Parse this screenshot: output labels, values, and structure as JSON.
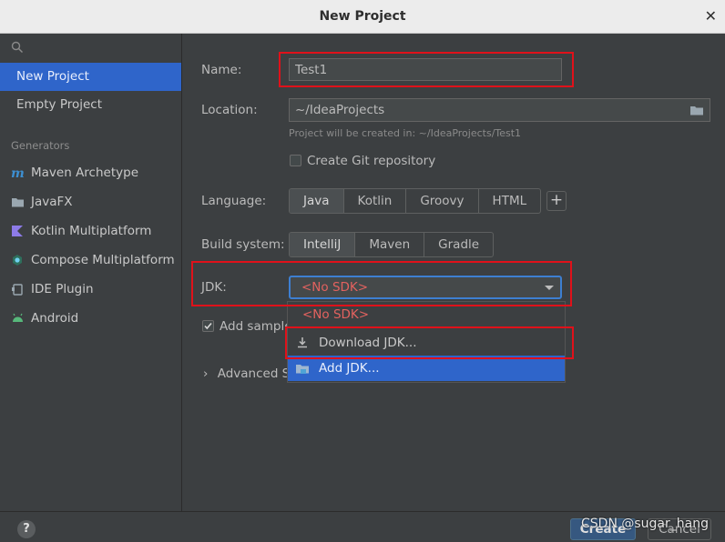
{
  "window": {
    "title": "New Project"
  },
  "sidebar": {
    "nav": [
      {
        "label": "New Project",
        "selected": true
      },
      {
        "label": "Empty Project",
        "selected": false
      }
    ],
    "generators_label": "Generators",
    "generators": [
      {
        "label": "Maven Archetype",
        "icon": "maven-icon",
        "color": "#3d8fd1"
      },
      {
        "label": "JavaFX",
        "icon": "folder-icon",
        "color": "#9aa7b0"
      },
      {
        "label": "Kotlin Multiplatform",
        "icon": "kotlin-icon",
        "color": "#8d7be8"
      },
      {
        "label": "Compose Multiplatform",
        "icon": "compose-icon",
        "color": "#4fc1a0"
      },
      {
        "label": "IDE Plugin",
        "icon": "plugin-icon",
        "color": "#9aa7b0"
      },
      {
        "label": "Android",
        "icon": "android-icon",
        "color": "#57b87b"
      }
    ]
  },
  "form": {
    "name_label": "Name:",
    "name_value": "Test1",
    "location_label": "Location:",
    "location_value": "~/IdeaProjects",
    "location_hint": "Project will be created in: ~/IdeaProjects/Test1",
    "git_label": "Create Git repository",
    "language_label": "Language:",
    "languages": [
      "Java",
      "Kotlin",
      "Groovy",
      "HTML"
    ],
    "build_label": "Build system:",
    "build_systems": [
      "IntelliJ",
      "Maven",
      "Gradle"
    ],
    "jdk_label": "JDK:",
    "jdk_value": "<No SDK>",
    "sample_label": "Add sample",
    "advanced_label": "Advanced Se"
  },
  "jdk_popup": {
    "items": [
      {
        "label": "<No SDK>",
        "color": "#e3625f"
      },
      {
        "label": "Download JDK...",
        "icon": "download-icon"
      },
      {
        "label": "Add JDK...",
        "icon": "folder-icon",
        "selected": true
      }
    ]
  },
  "footer": {
    "help": "?",
    "create": "Create",
    "cancel": "Cancel"
  },
  "watermark": "CSDN @sugar_hang",
  "colors": {
    "accent": "#2f65ca",
    "highlight": "#e0111a",
    "error": "#e3625f"
  }
}
